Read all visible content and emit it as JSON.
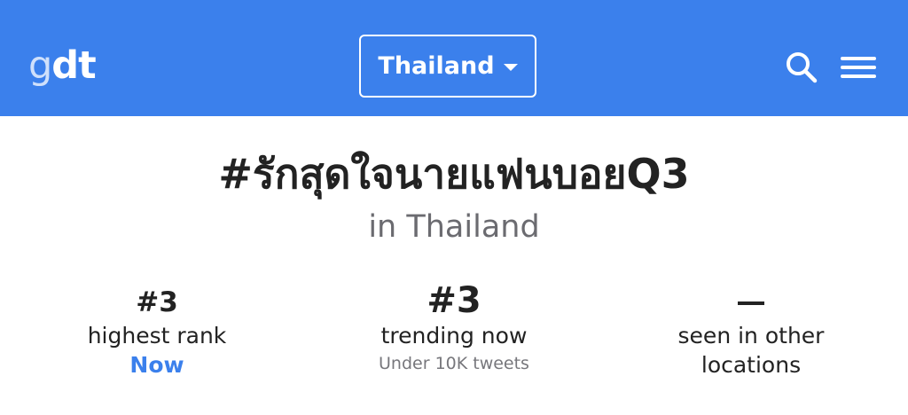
{
  "header": {
    "logo_g": "g",
    "logo_dt": "dt",
    "country": "Thailand",
    "icons": [
      "search-icon",
      "menu-icon",
      "chevron-down-icon"
    ],
    "colors": {
      "bar": "#3b80ec",
      "accent": "#3b80ec"
    }
  },
  "trend": {
    "title": "#รักสุดใจนายแฟนบอยQ3",
    "location": "in Thailand"
  },
  "stats": {
    "highest_rank": {
      "value": "#3",
      "label": "highest rank",
      "sub": "Now"
    },
    "trending_now": {
      "value": "#3",
      "label": "trending now",
      "sub": "Under 10K tweets"
    },
    "other_locations": {
      "value": "–",
      "label_line1": "seen in other",
      "label_line2": "locations"
    }
  }
}
